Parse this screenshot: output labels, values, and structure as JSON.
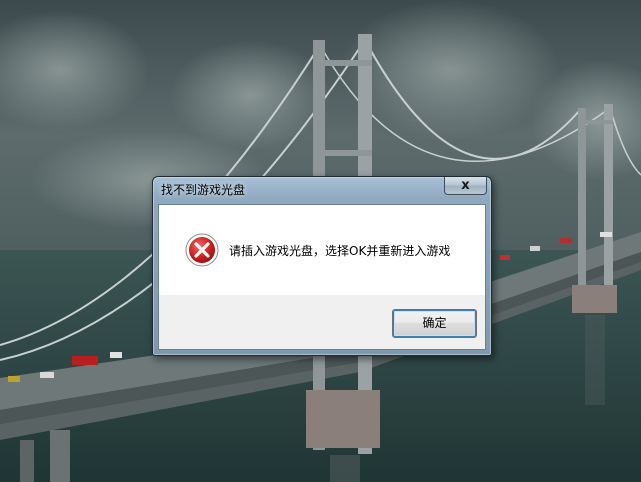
{
  "dialog": {
    "title": "找不到游戏光盘",
    "close_label": "x",
    "message": "请插入游戏光盘，选择OK并重新进入游戏",
    "ok_label": "确定",
    "icon": "error-icon"
  },
  "colors": {
    "error_red": "#cc1a1a",
    "sea": "#2f4746",
    "sky": "#4a5a5c"
  }
}
